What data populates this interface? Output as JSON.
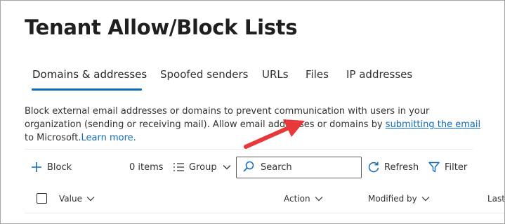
{
  "page": {
    "title": "Tenant Allow/Block Lists"
  },
  "tabs": [
    {
      "label": "Domains & addresses",
      "active": true
    },
    {
      "label": "Spoofed senders"
    },
    {
      "label": "URLs"
    },
    {
      "label": "Files"
    },
    {
      "label": "IP addresses"
    }
  ],
  "description": {
    "text_before": "Block external email addresses or domains to prevent communication with users in your organization (sending or receiving mail). Allow email addresses or domains by ",
    "link_text": "submitting the email",
    "text_after": " to Microsoft.",
    "learn_more": "Learn more."
  },
  "toolbar": {
    "block_label": "Block",
    "items_count": "0 items",
    "group_label": "Group",
    "search_placeholder": "Search",
    "refresh_label": "Refresh",
    "filter_label": "Filter"
  },
  "table": {
    "columns": [
      "Value",
      "Action",
      "Modified by",
      "Last"
    ]
  },
  "colors": {
    "accent": "#0f6cbd",
    "annotation_arrow": "#e8383a"
  },
  "icons": [
    "plus-icon",
    "group-list-icon",
    "chevron-down-icon",
    "search-icon",
    "refresh-icon",
    "filter-icon",
    "red-arrow-annotation"
  ]
}
